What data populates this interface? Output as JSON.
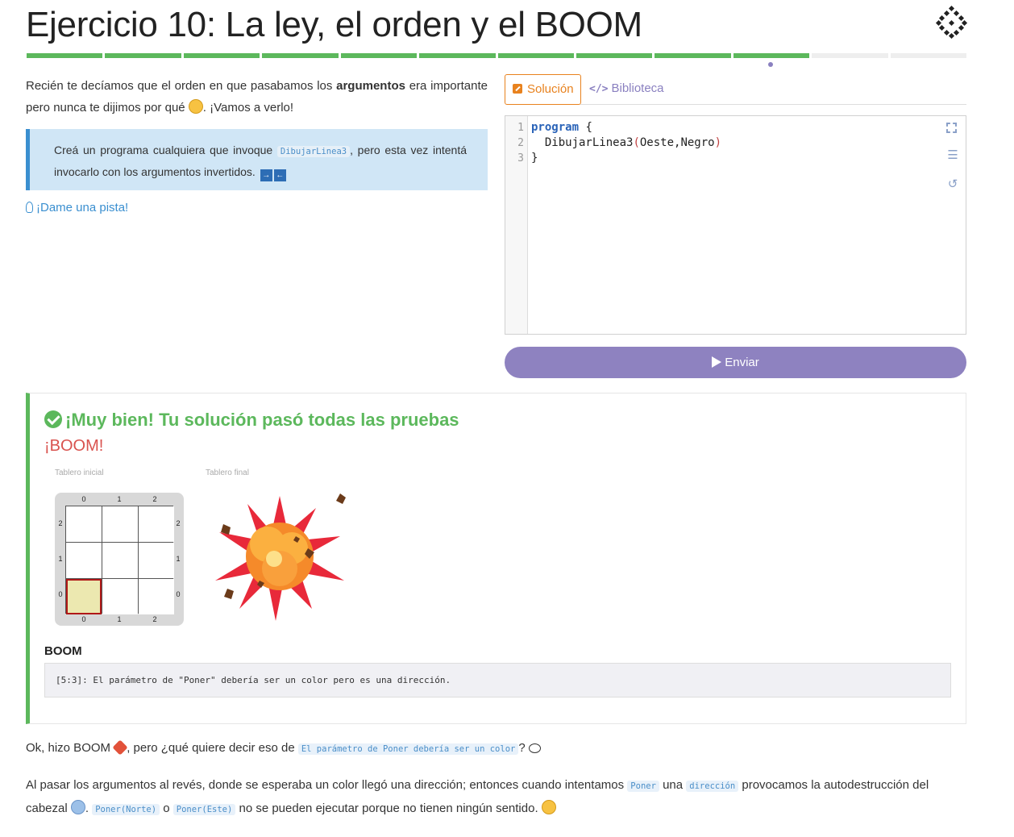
{
  "header": {
    "title": "Ejercicio 10: La ley, el orden y el BOOM",
    "progress_total": 12,
    "progress_done": 10
  },
  "intro": {
    "text_before": "Recién te decíamos que el orden en que pasabamos los ",
    "bold": "argumentos",
    "text_after": " era importante pero nunca te dijimos por qué ",
    "text_end": ". ¡Vamos a verlo!"
  },
  "callout": {
    "text_before": "Creá un programa cualquiera que invoque ",
    "code": "DibujarLinea3",
    "text_after": ", pero esta vez intentá invocarlo con los argumentos invertidos. ",
    "arrow_right": "→",
    "arrow_left": "←"
  },
  "hint": {
    "label": "¡Dame una pista!"
  },
  "tabs": {
    "solution": "Solución",
    "library": "Biblioteca",
    "library_glyph": "</>"
  },
  "editor": {
    "line_numbers": [
      "1",
      "2",
      "3"
    ],
    "line1_kw": "program",
    "line1_rest": " {",
    "line2_indent": "  ",
    "line2_func": "DibujarLinea3",
    "line2_open": "(",
    "line2_args": "Oeste,Negro",
    "line2_close": ")",
    "line3": "}"
  },
  "submit": {
    "label": "Enviar"
  },
  "result": {
    "title": "¡Muy bien! Tu solución pasó todas las pruebas",
    "boom": "¡BOOM!",
    "initial_label": "Tablero inicial",
    "final_label": "Tablero final",
    "columns": [
      "0",
      "1",
      "2"
    ],
    "rows": [
      "2",
      "1",
      "0"
    ],
    "boom_heading": "BOOM",
    "console": "[5:3]: El parámetro de \"Poner\" debería ser un color pero es una dirección."
  },
  "footer": {
    "p1_before": "Ok, hizo BOOM ",
    "p1_mid": ", pero ¿qué quiere decir eso de ",
    "p1_code": "El parámetro de Poner debería ser un color",
    "p1_after": "? ",
    "p2_before": "Al pasar los argumentos al revés, donde se esperaba un color llegó una dirección; entonces cuando intentamos ",
    "p2_code1": "Poner",
    "p2_mid1": " una ",
    "p2_code2": "dirección",
    "p2_mid2": " provocamos la autodestrucción del cabezal ",
    "p2_mid3": ". ",
    "p2_code3": "Poner(Norte)",
    "p2_mid4": " o ",
    "p2_code4": "Poner(Este)",
    "p2_end": " no se pueden ejecutar porque no tienen ningún sentido. "
  },
  "colors": {
    "accent_green": "#5cb85c",
    "accent_purple": "#8e82c0",
    "accent_orange": "#e8821e",
    "accent_blue": "#3a8fd0",
    "error_red": "#d9534f"
  }
}
